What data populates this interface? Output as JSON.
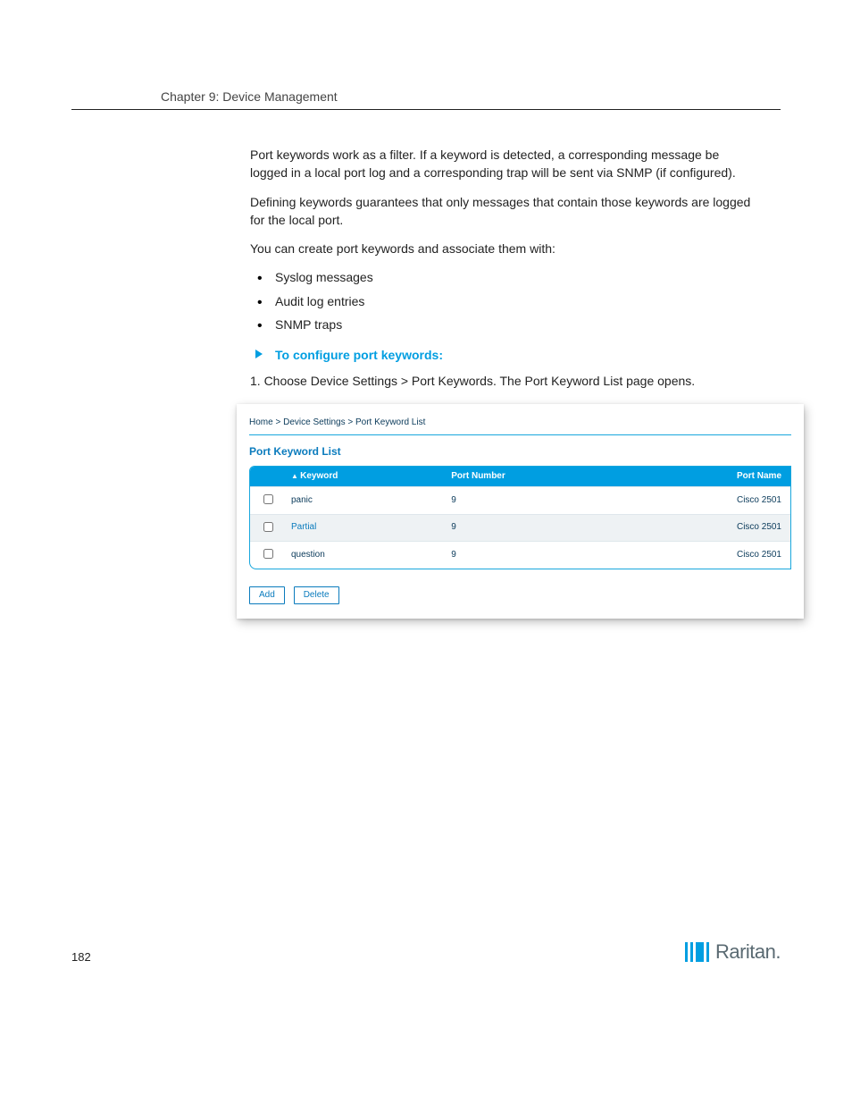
{
  "doc": {
    "chapter_title": "Chapter 9: Device Management"
  },
  "text": {
    "p1": "Port keywords work as a filter. If a keyword is detected, a corresponding message be logged in a local port log and a corresponding trap will be sent via SNMP (if configured).",
    "p2": "Defining keywords guarantees that only messages that contain those keywords are logged for the local port.",
    "p3": "You can create port keywords and associate them with:",
    "li1": "Syslog messages",
    "li2": "Audit log entries",
    "li3": "SNMP traps",
    "to_config": "To configure port keywords:",
    "step1": "1.  Choose Device Settings > Port Keywords. The Port Keyword List page opens."
  },
  "screenshot": {
    "breadcrumb": {
      "a": "Home",
      "b": "Device Settings",
      "c": "Port Keyword List"
    },
    "title": "Port Keyword List",
    "headers": {
      "keyword": "Keyword",
      "portnum": "Port Number",
      "portname": "Port Name"
    },
    "rows": [
      {
        "keyword": "panic",
        "num": "9",
        "name": "Cisco 2501",
        "link": false
      },
      {
        "keyword": "Partial",
        "num": "9",
        "name": "Cisco 2501",
        "link": true
      },
      {
        "keyword": "question",
        "num": "9",
        "name": "Cisco 2501",
        "link": false
      }
    ],
    "buttons": {
      "add": "Add",
      "del": "Delete"
    }
  },
  "footer": {
    "page": "182",
    "brand": "Raritan."
  }
}
